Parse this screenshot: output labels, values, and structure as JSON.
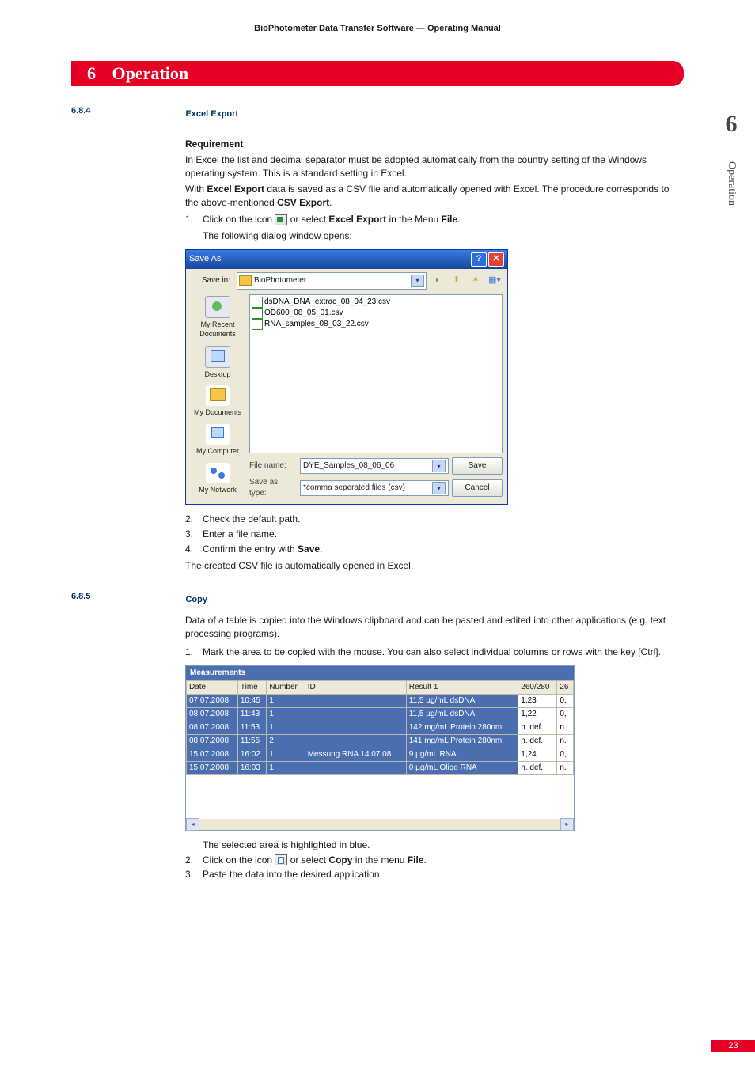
{
  "header": "BioPhotometer Data Transfer Software  —  Operating Manual",
  "chapter": {
    "num": "6",
    "title": "Operation"
  },
  "side": {
    "big": "6",
    "vert": "Operation"
  },
  "page_num": "23",
  "s684": {
    "num": "6.8.4",
    "title": "Excel Export",
    "req_h": "Requirement",
    "req_p1": "In Excel the list and decimal separator must be adopted automatically from the country setting of the Windows operating system. This is a standard setting in Excel.",
    "req_p2a": "With ",
    "req_p2b": "Excel Export",
    "req_p2c": " data is saved as a CSV file and automatically opened with Excel. The procedure corresponds to the above-mentioned ",
    "req_p2d": "CSV Export",
    "req_p2e": ".",
    "step1a": "Click on the icon ",
    "step1b": " or select ",
    "step1c": "Excel Export",
    "step1d": " in the Menu ",
    "step1e": "File",
    "step1f": ".",
    "step1_sub": "The following dialog window opens:",
    "step2": "Check the default path.",
    "step3": "Enter a file name.",
    "step4a": "Confirm the entry with ",
    "step4b": "Save",
    "step4c": ".",
    "after": "The created CSV file is automatically opened in Excel."
  },
  "saveas": {
    "title": "Save As",
    "save_in_lbl": "Save in:",
    "folder": "BioPhotometer",
    "files": [
      "dsDNA_DNA_extrac_08_04_23.csv",
      "OD600_08_05_01.csv",
      "RNA_samples_08_03_22.csv"
    ],
    "places": {
      "recent": "My Recent Documents",
      "desktop": "Desktop",
      "docs": "My Documents",
      "comp": "My Computer",
      "net": "My Network"
    },
    "filename_lbl": "File name:",
    "filename_val": "DYE_Samples_08_06_06",
    "type_lbl": "Save as type:",
    "type_val": "*comma seperated files (csv)",
    "save_btn": "Save",
    "cancel_btn": "Cancel"
  },
  "s685": {
    "num": "6.8.5",
    "title": "Copy",
    "p1": "Data of a table is copied into the Windows clipboard and can be pasted and edited into other applications (e.g. text processing programs).",
    "step1": "Mark the area to be copied with the mouse. You can also select individual columns or rows with the key [Ctrl].",
    "after1": "The selected area is highlighted in blue.",
    "step2a": "Click on the icon ",
    "step2b": " or select ",
    "step2c": "Copy",
    "step2d": " in the menu ",
    "step2e": "File",
    "step2f": ".",
    "step3": "Paste the data into the desired application."
  },
  "measurements": {
    "title": "Measurements",
    "headers": [
      "Date",
      "Time",
      "Number",
      "ID",
      "Result 1",
      "260/280",
      "26"
    ],
    "rows": [
      [
        "07.07.2008",
        "10:45",
        "1",
        "",
        "11,5 µg/mL dsDNA",
        "1,23",
        "0,"
      ],
      [
        "08.07.2008",
        "11:43",
        "1",
        "",
        "11,5 µg/mL dsDNA",
        "1,22",
        "0,"
      ],
      [
        "08.07.2008",
        "11:53",
        "1",
        "",
        "142 mg/mL Protein 280nm",
        "n. def.",
        "n."
      ],
      [
        "08.07.2008",
        "11:55",
        "2",
        "",
        "141 mg/mL Protein 280nm",
        "n. def.",
        "n."
      ],
      [
        "15.07.2008",
        "16:02",
        "1",
        "Messung RNA 14.07.08",
        "9 µg/mL RNA",
        "1,24",
        "0,"
      ],
      [
        "15.07.2008",
        "16:03",
        "1",
        "",
        "0 µg/mL Oligo RNA",
        "n. def.",
        "n."
      ]
    ]
  }
}
